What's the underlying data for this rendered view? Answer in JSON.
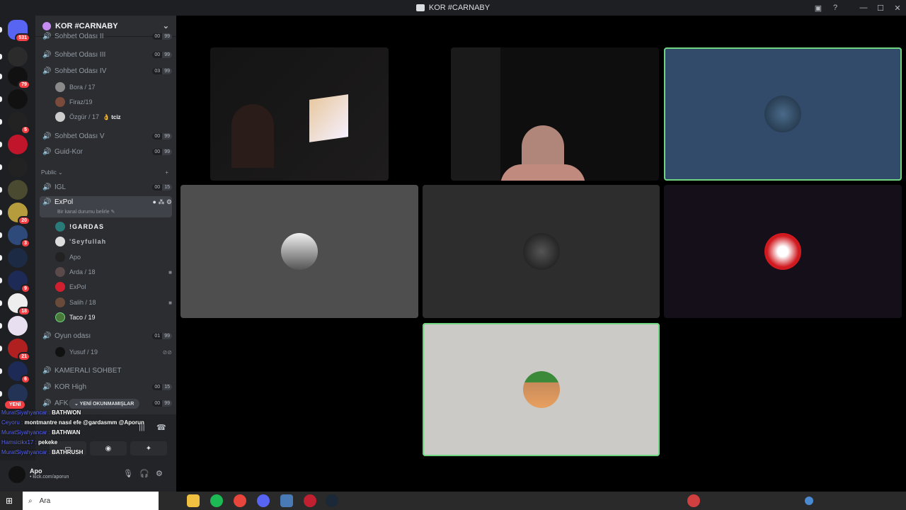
{
  "window": {
    "title": "KOR #CARNABY",
    "help": "?",
    "minimize": "—",
    "maximize": "☐",
    "close": "✕"
  },
  "servers": [
    {
      "name": "discord-home",
      "badge": "531",
      "color": "#5865f2"
    },
    {
      "name": "server-2",
      "badge": "",
      "color": "#2b2b2b"
    },
    {
      "name": "server-3",
      "badge": "79",
      "color": "#111"
    },
    {
      "name": "server-4",
      "badge": "",
      "color": "#111"
    },
    {
      "name": "server-5",
      "badge": "5",
      "color": "#222"
    },
    {
      "name": "server-6",
      "badge": "",
      "color": "#c0152a"
    },
    {
      "name": "server-7",
      "badge": "",
      "color": "#222"
    },
    {
      "name": "server-8",
      "badge": "",
      "color": "#4a4a30"
    },
    {
      "name": "server-9",
      "badge": "20",
      "color": "#b69c3c"
    },
    {
      "name": "server-10",
      "badge": "3",
      "color": "#2e4a7a"
    },
    {
      "name": "server-11",
      "badge": "",
      "color": "#1c2a44"
    },
    {
      "name": "server-12",
      "badge": "9",
      "color": "#1d2a55"
    },
    {
      "name": "server-13",
      "badge": "18",
      "color": "#eee"
    },
    {
      "name": "server-14",
      "badge": "",
      "color": "#e8e0f0"
    },
    {
      "name": "server-15",
      "badge": "21",
      "color": "#b02020"
    },
    {
      "name": "server-16",
      "badge": "6",
      "color": "#1d2a55"
    },
    {
      "name": "server-17",
      "badge": "",
      "color": "#223355"
    }
  ],
  "guild": {
    "name": "KOR #CARNABY",
    "chevron": "⌄"
  },
  "channels": {
    "sohbet2": {
      "name": "Sohbet Odası II",
      "a": "00",
      "b": "99"
    },
    "sohbet3": {
      "name": "Sohbet Odası III",
      "a": "00",
      "b": "99"
    },
    "sohbet4": {
      "name": "Sohbet Odası IV",
      "a": "03",
      "b": "99"
    },
    "sohbet5": {
      "name": "Sohbet Odası V",
      "a": "00",
      "b": "99"
    },
    "guid": {
      "name": "Guid-Kor",
      "a": "00",
      "b": "99"
    },
    "igl": {
      "name": "IGL",
      "a": "00",
      "b": "15"
    },
    "expol": {
      "name": "ExPol",
      "subtitle": "Bir kanal durumu belirle ✎"
    },
    "oyun": {
      "name": "Oyun odası",
      "a": "01",
      "b": "99"
    },
    "kamerali": {
      "name": "KAMERALI SOHBET"
    },
    "korhigh": {
      "name": "KOR High",
      "a": "00",
      "b": "15"
    },
    "afk": {
      "name": "AFK",
      "a": "00",
      "b": "99"
    }
  },
  "section_public": {
    "label": "Public ⌄",
    "plus": "+"
  },
  "users_sohbet4": [
    "Bora / 17",
    "Firaz/19",
    "Özgür / 17"
  ],
  "ozgur_tag": "👌 tciz",
  "users_expol": [
    "!GARDAS",
    "'Seyfullah",
    "Apo",
    "Arda / 18",
    "ExPol",
    "Salih / 18",
    "Taco / 19"
  ],
  "users_oyun": [
    "Yusuf / 19"
  ],
  "unread_label": "⌄ YENİ OKUNMAMIŞLAR",
  "new_label": "YENİ",
  "chat": [
    {
      "name": "MuratSiyahyancar :",
      "msg": "BATHWON"
    },
    {
      "name": "Ceyoru :",
      "msg": "montmantre nasıl efe @gardasmm @Aporun"
    },
    {
      "name": "MuratSiyahyancar :",
      "msg": "BATHWAN"
    },
    {
      "name": "Hamsicikx17 :",
      "msg": "pekeke"
    },
    {
      "name": "MuratSiyahyancar :",
      "msg": "BATHRUSH"
    }
  ],
  "user_panel": {
    "name": "Apo",
    "status": "• kick.com/aporun"
  },
  "taskbar": {
    "search_placeholder": "Ara"
  },
  "colors": {
    "accent": "#5865f2",
    "danger": "#f23f43",
    "speaking": "#6ed47f"
  }
}
